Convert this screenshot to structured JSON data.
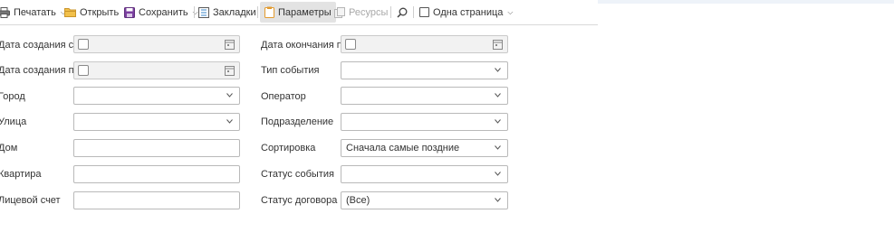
{
  "toolbar": {
    "print": "Печатать",
    "open": "Открыть",
    "save": "Сохранить",
    "bookmarks": "Закладки",
    "parameters": "Параметры",
    "resources": "Ресурсы",
    "single_page": "Одна страница"
  },
  "params": {
    "date_created_from": {
      "label": "Дата создания с",
      "value": ""
    },
    "date_created_to": {
      "label": "Дата создания по",
      "value": ""
    },
    "city": {
      "label": "Город",
      "value": ""
    },
    "street": {
      "label": "Улица",
      "value": ""
    },
    "house": {
      "label": "Дом",
      "value": ""
    },
    "apartment": {
      "label": "Квартира",
      "value": ""
    },
    "account": {
      "label": "Лицевой счет",
      "value": ""
    },
    "date_end_to": {
      "label": "Дата окончания по",
      "value": ""
    },
    "event_type": {
      "label": "Тип события",
      "value": ""
    },
    "operator": {
      "label": "Оператор",
      "value": ""
    },
    "department": {
      "label": "Подразделение",
      "value": ""
    },
    "sorting": {
      "label": "Сортировка",
      "value": "Сначала самые поздние"
    },
    "event_status": {
      "label": "Статус события",
      "value": ""
    },
    "contract_status": {
      "label": "Статус договора",
      "value": "(Все)"
    }
  }
}
